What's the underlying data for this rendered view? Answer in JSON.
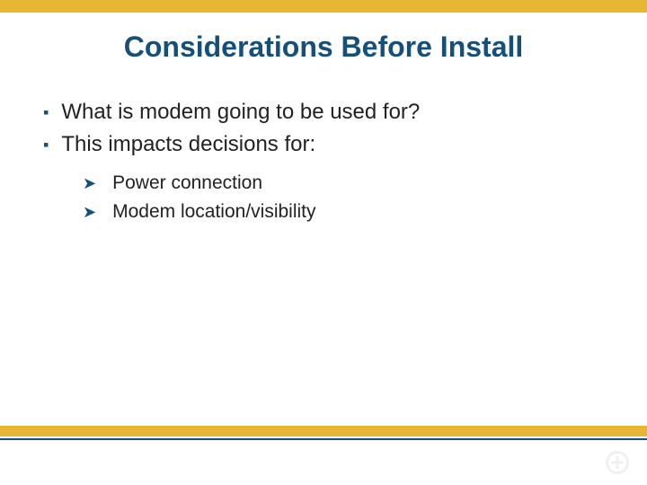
{
  "title": "Considerations Before Install",
  "bullets": [
    {
      "text": "What is modem going to be used for?"
    },
    {
      "text": "This impacts decisions for:"
    }
  ],
  "sub_bullets": [
    {
      "text": "Power connection"
    },
    {
      "text": "Modem location/visibility"
    }
  ],
  "logo_text": "",
  "colors": {
    "accent_bar": "#e6b733",
    "brand_blue": "#164f7a"
  }
}
